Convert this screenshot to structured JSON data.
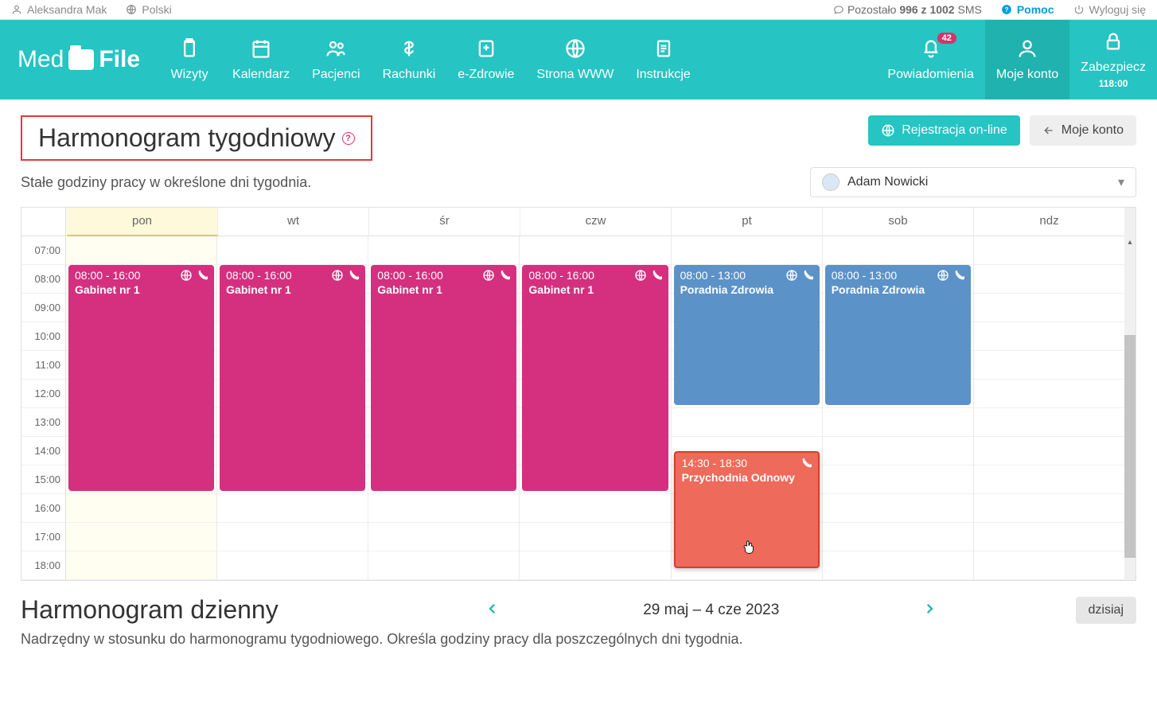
{
  "topbar": {
    "user": "Aleksandra Mak",
    "language": "Polski",
    "sms_prefix": "Pozostało",
    "sms_count": "996 z 1002",
    "sms_suffix": "SMS",
    "help": "Pomoc",
    "logout": "Wyloguj się"
  },
  "logo": {
    "text1": "Med",
    "text2": "File"
  },
  "nav": {
    "items": [
      {
        "label": "Wizyty"
      },
      {
        "label": "Kalendarz"
      },
      {
        "label": "Pacjenci"
      },
      {
        "label": "Rachunki"
      },
      {
        "label": "e-Zdrowie"
      },
      {
        "label": "Strona WWW"
      },
      {
        "label": "Instrukcje"
      }
    ],
    "right": {
      "notifications_label": "Powiadomienia",
      "badge": "42",
      "account_label": "Moje konto",
      "secure_label": "Zabezpiecz",
      "secure_time": "118:00"
    }
  },
  "page": {
    "title": "Harmonogram tygodniowy",
    "subtitle": "Stałe godziny pracy w określone dni tygodnia.",
    "btn_register": "Rejestracja on-line",
    "btn_account": "Moje konto",
    "doctor": "Adam Nowicki"
  },
  "calendar": {
    "days": [
      "pon",
      "wt",
      "śr",
      "czw",
      "pt",
      "sob",
      "ndz"
    ],
    "today_index": 0,
    "hours": [
      "07:00",
      "08:00",
      "09:00",
      "10:00",
      "11:00",
      "12:00",
      "13:00",
      "14:00",
      "15:00",
      "16:00",
      "17:00",
      "18:00"
    ],
    "events": [
      {
        "day": 0,
        "start": 1,
        "end": 9,
        "time": "08:00 - 16:00",
        "place": "Gabinet nr 1",
        "color": "pink",
        "globe": true,
        "phone": true
      },
      {
        "day": 1,
        "start": 1,
        "end": 9,
        "time": "08:00 - 16:00",
        "place": "Gabinet nr 1",
        "color": "pink",
        "globe": true,
        "phone": true
      },
      {
        "day": 2,
        "start": 1,
        "end": 9,
        "time": "08:00 - 16:00",
        "place": "Gabinet nr 1",
        "color": "pink",
        "globe": true,
        "phone": true
      },
      {
        "day": 3,
        "start": 1,
        "end": 9,
        "time": "08:00 - 16:00",
        "place": "Gabinet nr 1",
        "color": "pink",
        "globe": true,
        "phone": true
      },
      {
        "day": 4,
        "start": 1,
        "end": 6,
        "time": "08:00 - 13:00",
        "place": "Poradnia Zdrowia",
        "color": "blue",
        "globe": true,
        "phone": true
      },
      {
        "day": 5,
        "start": 1,
        "end": 6,
        "time": "08:00 - 13:00",
        "place": "Poradnia Zdrowia",
        "color": "blue",
        "globe": true,
        "phone": true
      },
      {
        "day": 4,
        "start": 7.5,
        "end": 11.7,
        "time": "14:30 - 18:30",
        "place": "Przychodnia Odnowy",
        "color": "red",
        "globe": false,
        "phone": true
      }
    ]
  },
  "daily": {
    "title": "Harmonogram dzienny",
    "range": "29 maj – 4 cze 2023",
    "today_btn": "dzisiaj",
    "subtitle": "Nadrzędny w stosunku do harmonogramu tygodniowego. Określa godziny pracy dla poszczególnych dni tygodnia."
  }
}
